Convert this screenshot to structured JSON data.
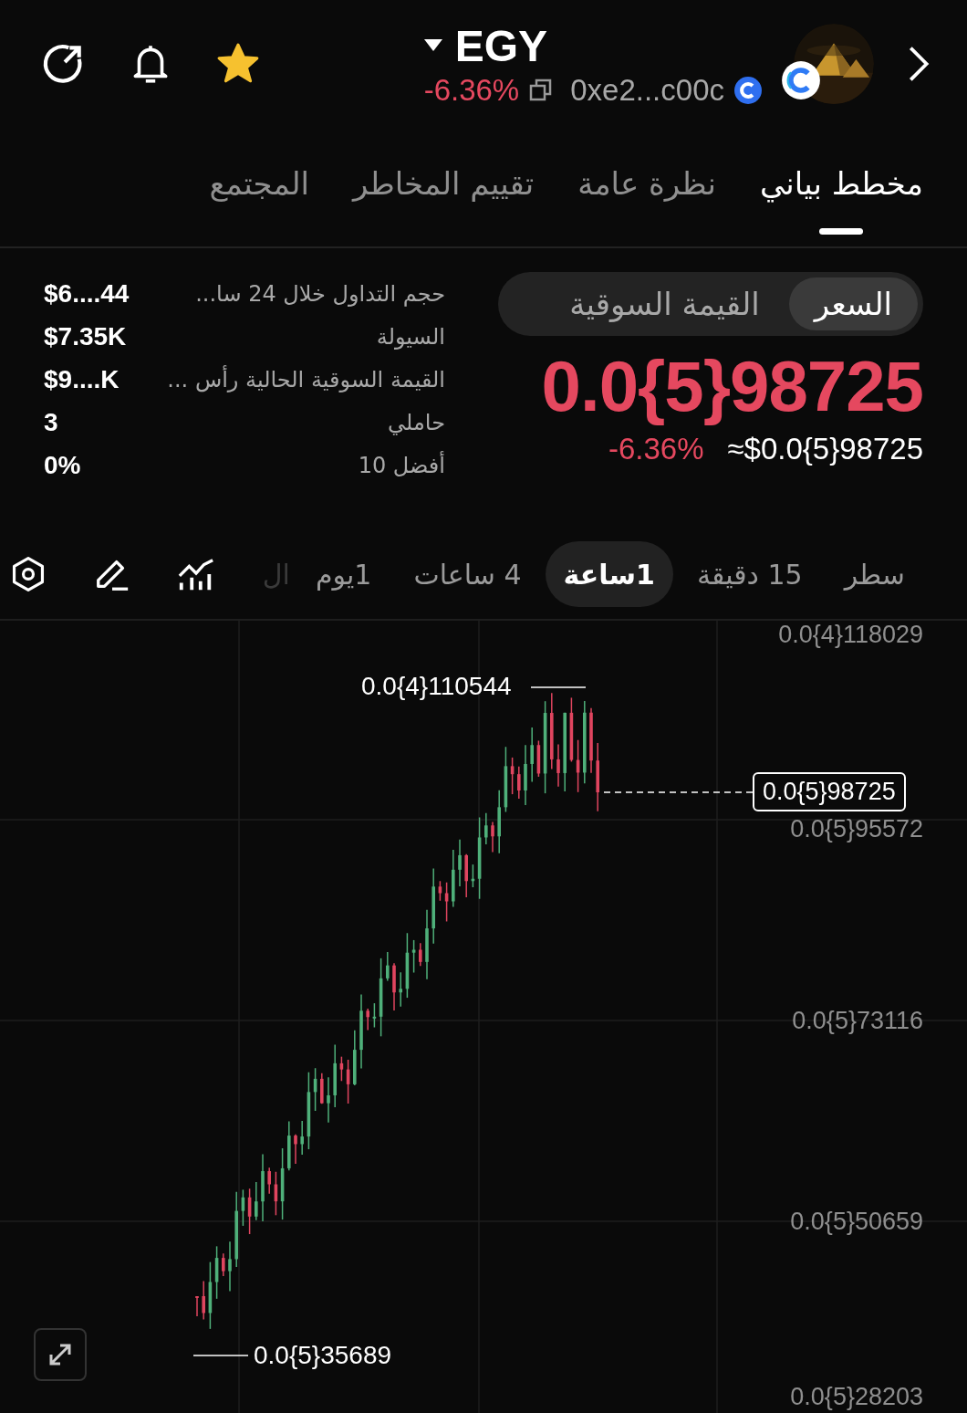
{
  "header": {
    "symbol": "EGY",
    "change": "-6.36%",
    "address": "0xe2...c00c",
    "favorite": true
  },
  "tabs": [
    {
      "label": "مخطط بياني",
      "selected": true
    },
    {
      "label": "نظرة عامة",
      "selected": false
    },
    {
      "label": "تقييم المخاطر",
      "selected": false
    },
    {
      "label": "المجتمع",
      "selected": false
    }
  ],
  "price_toggle": [
    {
      "label": "السعر",
      "selected": true
    },
    {
      "label": "القيمة السوقية",
      "selected": false
    }
  ],
  "price": {
    "value": "0.0{5}98725",
    "change": "-6.36%",
    "usd": "≈$0.0{5}98725"
  },
  "stats": [
    {
      "label": "حجم التداول خلال 24 سا...",
      "value": "$6....44"
    },
    {
      "label": "السيولة",
      "value": "$7.35K"
    },
    {
      "label": "القيمة السوقية الحالية رأس ...",
      "value": "$9....K"
    },
    {
      "label": "حاملي",
      "value": "3"
    },
    {
      "label": "أفضل 10",
      "value": "0%"
    }
  ],
  "intervals": [
    {
      "label": "سطر",
      "selected": false,
      "faded": false
    },
    {
      "label": "15 دقيقة",
      "selected": false,
      "faded": false
    },
    {
      "label": "1ساعة",
      "selected": true,
      "faded": false
    },
    {
      "label": "4 ساعات",
      "selected": false,
      "faded": false
    },
    {
      "label": "1يوم",
      "selected": false,
      "faded": false
    },
    {
      "label": "ال",
      "selected": false,
      "faded": true
    }
  ],
  "chart": {
    "y_labels": [
      "0.0{4}118029",
      "0.0{5}95572",
      "0.0{5}73116",
      "0.0{5}50659",
      "0.0{5}28203"
    ],
    "high_label": "0.0{4}110544",
    "low_label": "0.0{5}35689",
    "current_label": "0.0{5}98725"
  }
}
